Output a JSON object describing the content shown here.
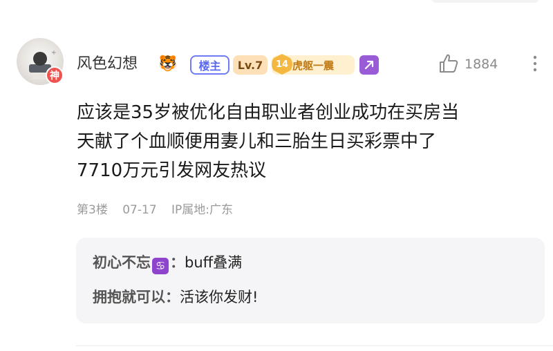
{
  "post": {
    "username": "风色幻想",
    "username_emoji": "🐯",
    "tag_op": "楼主",
    "level": "Lv.7",
    "badge_number": "14",
    "badge_title": "虎躯一震",
    "avatar_badge": "神",
    "like_count": "1884",
    "content_lines": [
      "应该是35岁被优化自由职业者创业成功在买房当",
      "天献了个血顺便用妻儿和三胎生日买彩票中了",
      "7710万元引发网友热议"
    ],
    "floor": "第3楼",
    "date": "07-17",
    "ip_location": "IP属地:广东"
  },
  "replies": [
    {
      "name": "初心不忘",
      "emoji": "♋",
      "separator": "：",
      "text": "buff叠满"
    },
    {
      "name": "拥抱就可以",
      "emoji": "",
      "separator": "：",
      "text": "活该你发财!"
    }
  ],
  "icons": {
    "like": "thumbs-up-icon",
    "more": "more-vertical-icon",
    "share": "share-arrow-icon"
  },
  "colors": {
    "op_tag": "#5a68ef",
    "level_bg": "#fde0b8",
    "badge_bg": "#fff1d0",
    "share_bg": "#9a5cd6",
    "avatar_badge_bg": "#ef5350",
    "reply_bg": "#f5f5f7"
  }
}
